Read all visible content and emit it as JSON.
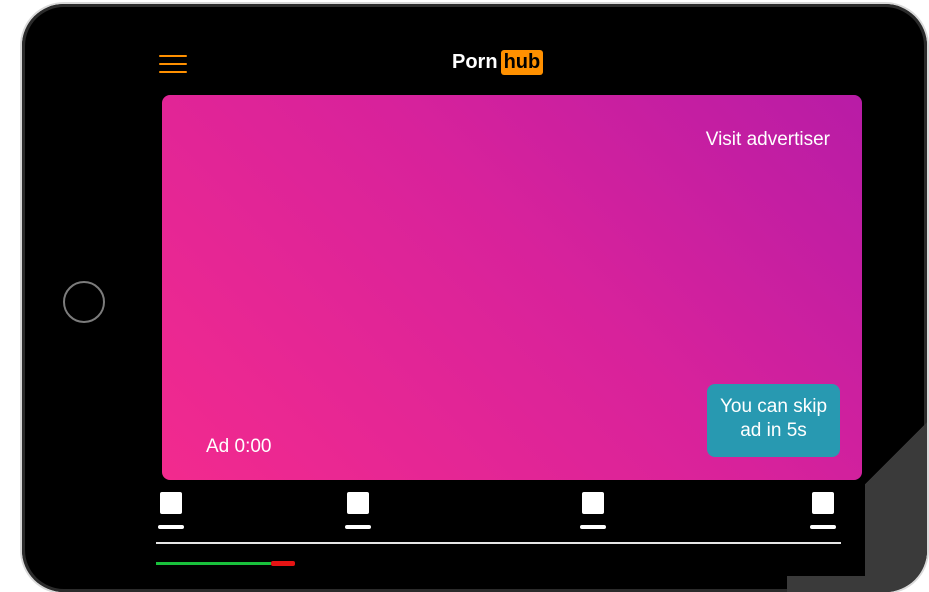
{
  "header": {
    "logo_part1": "Porn",
    "logo_part2": "hub"
  },
  "ad": {
    "visit_label": "Visit advertiser",
    "time_label": "Ad 0:00",
    "skip_line1": "You can skip",
    "skip_line2": "ad in 5s"
  },
  "colors": {
    "brand_orange": "#ff9000",
    "ad_gradient_start": "#b81ca6",
    "ad_gradient_end": "#f22a8e",
    "skip_button": "#2899b1",
    "progress_played": "#19c13c",
    "progress_ad_marker": "#e51414"
  },
  "icons": {
    "menu": "hamburger-menu-icon",
    "nav_tabs": [
      "square-tab-icon",
      "square-tab-icon",
      "square-tab-icon",
      "square-tab-icon"
    ]
  }
}
